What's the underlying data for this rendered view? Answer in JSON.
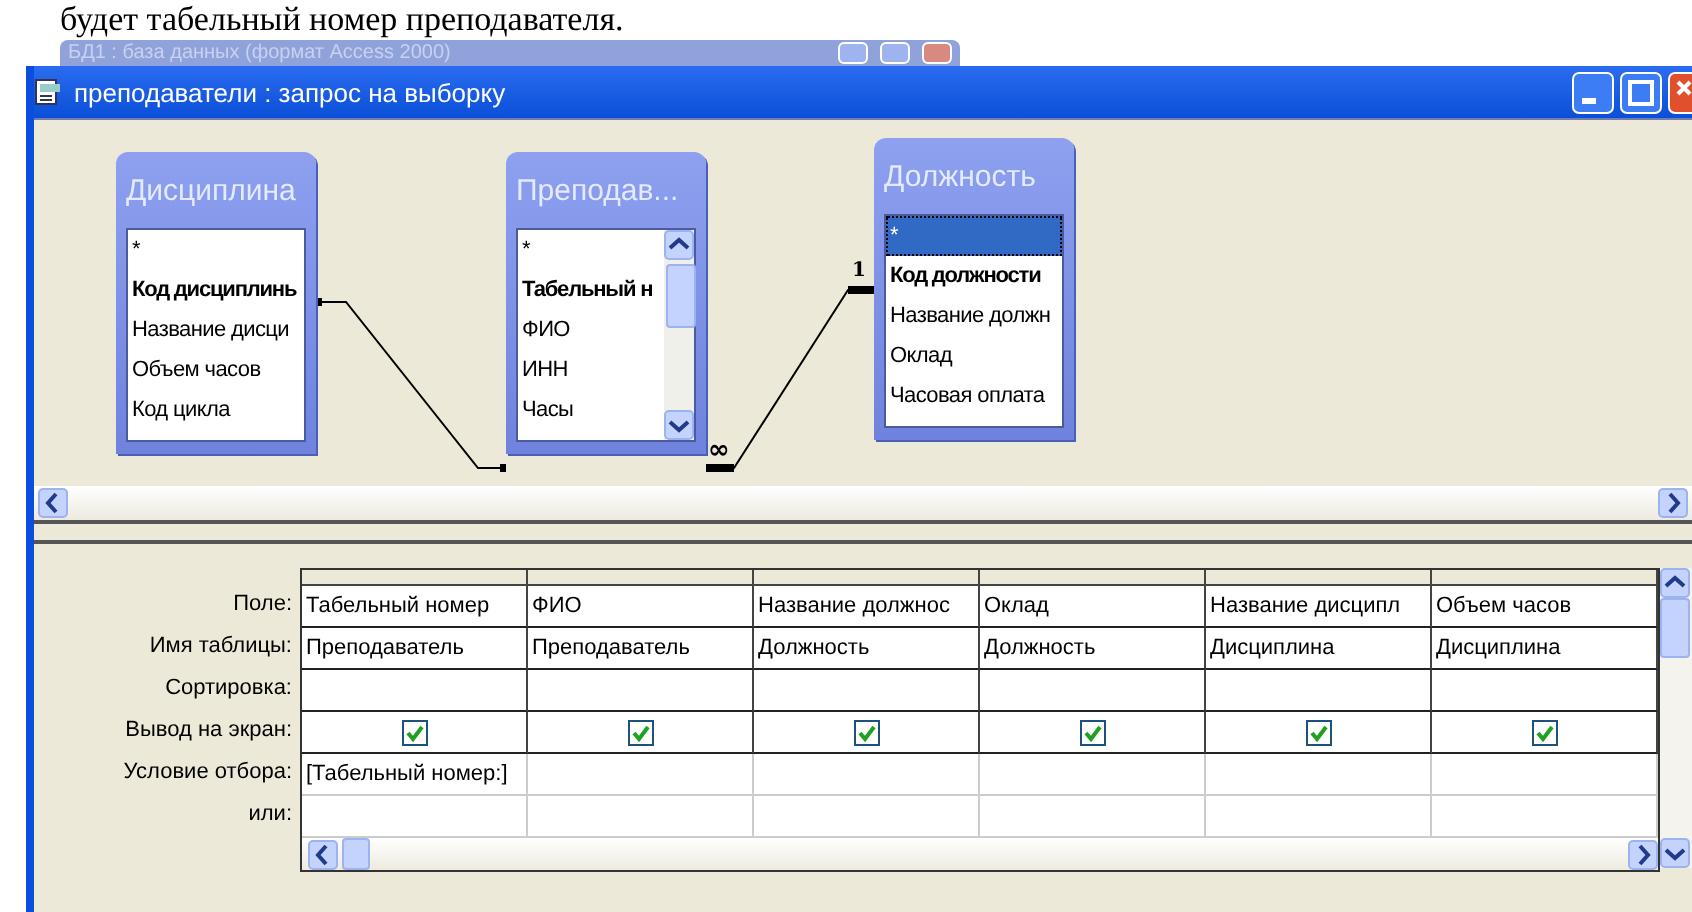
{
  "document_text": "будет табельный номер преподавателя.",
  "background_window": {
    "title": "БД1 : база данных (формат Access 2000)"
  },
  "window": {
    "title": "преподаватели : запрос на выборку"
  },
  "tables": [
    {
      "title": "Дисциплина",
      "scrollable": false,
      "fields": [
        {
          "name": "*",
          "primary_key": false,
          "selected": false
        },
        {
          "name": "Код дисциплинь",
          "primary_key": true,
          "selected": false
        },
        {
          "name": "Название дисци",
          "primary_key": false,
          "selected": false
        },
        {
          "name": "Объем часов",
          "primary_key": false,
          "selected": false
        },
        {
          "name": "Код цикла",
          "primary_key": false,
          "selected": false
        }
      ]
    },
    {
      "title": "Преподав...",
      "scrollable": true,
      "fields": [
        {
          "name": "*",
          "primary_key": false,
          "selected": false
        },
        {
          "name": "Табельный н",
          "primary_key": true,
          "selected": false
        },
        {
          "name": "ФИО",
          "primary_key": false,
          "selected": false
        },
        {
          "name": "ИНН",
          "primary_key": false,
          "selected": false
        },
        {
          "name": "Часы",
          "primary_key": false,
          "selected": false
        }
      ]
    },
    {
      "title": "Должность",
      "scrollable": false,
      "fields": [
        {
          "name": "*",
          "primary_key": false,
          "selected": true
        },
        {
          "name": "Код должности",
          "primary_key": true,
          "selected": false
        },
        {
          "name": "Название должн",
          "primary_key": false,
          "selected": false
        },
        {
          "name": "Оклад",
          "primary_key": false,
          "selected": false
        },
        {
          "name": "Часовая оплата",
          "primary_key": false,
          "selected": false
        }
      ]
    }
  ],
  "relationship_labels": {
    "many": "∞",
    "one": "1"
  },
  "grid": {
    "row_labels": [
      "Поле:",
      "Имя таблицы:",
      "Сортировка:",
      "Вывод на экран:",
      "Условие отбора:",
      "или:"
    ],
    "columns": [
      {
        "field": "Табельный номер",
        "table": "Преподаватель",
        "show": true,
        "criteria": "[Табельный номер:]"
      },
      {
        "field": "ФИО",
        "table": "Преподаватель",
        "show": true
      },
      {
        "field": "Название должнос",
        "table": "Должность",
        "show": true
      },
      {
        "field": "Оклад",
        "table": "Должность",
        "show": true
      },
      {
        "field": "Название дисципл",
        "table": "Дисциплина",
        "show": true
      },
      {
        "field": "Объем часов",
        "table": "Дисциплина",
        "show": true
      }
    ]
  }
}
